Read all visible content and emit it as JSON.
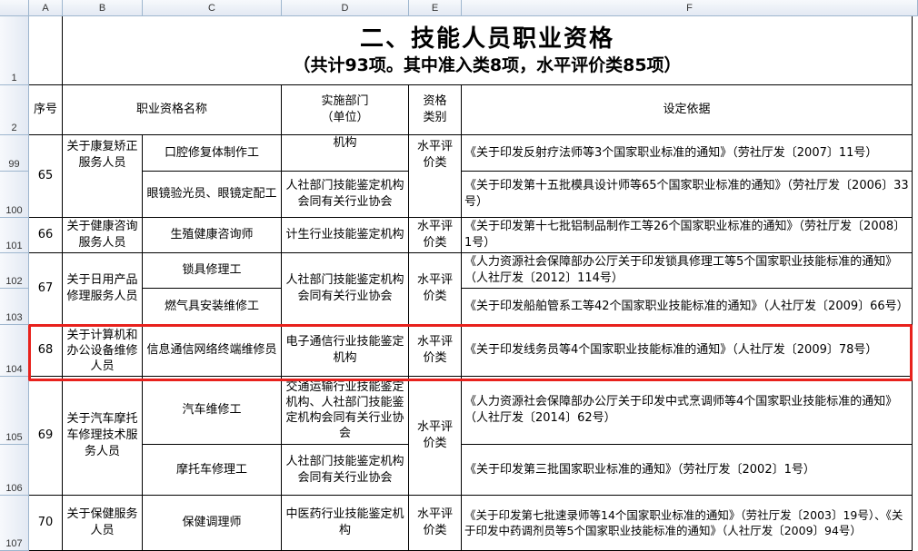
{
  "columns": [
    "A",
    "B",
    "C",
    "D",
    "E",
    "F"
  ],
  "row_numbers": [
    "1",
    "2",
    "99",
    "100",
    "101",
    "102",
    "103",
    "104",
    "105",
    "106",
    "107"
  ],
  "title": {
    "main": "二、技能人员职业资格",
    "sub": "（共计93项。其中准入类8项，水平评价类85项）"
  },
  "header": {
    "seq": "序号",
    "name": "职业资格名称",
    "dept": "实施部门\n（单位）",
    "type": "资格\n类别",
    "basis": "设定依据"
  },
  "rows": {
    "r65": {
      "seq": "65",
      "group": "关于康复矫正服务人员",
      "type": "水平评价类",
      "items": [
        {
          "name": "口腔修复体制作工",
          "dept": "机构",
          "basis": "《关于印发反射疗法师等3个国家职业标准的通知》（劳社厅发〔2007〕11号）"
        },
        {
          "name": "眼镜验光员、眼镜定配工",
          "dept": "人社部门技能鉴定机构会同有关行业协会",
          "basis": "《关于印发第十五批模具设计师等65个国家职业标准的通知》（劳社厅发〔2006〕33号）"
        }
      ]
    },
    "r66": {
      "seq": "66",
      "group": "关于健康咨询服务人员",
      "name": "生殖健康咨询师",
      "dept": "计生行业技能鉴定机构",
      "type": "水平评价类",
      "basis": "《关于印发第十七批铝制品制作工等26个国家职业标准的通知》（劳社厅发〔2008〕1号）"
    },
    "r67": {
      "seq": "67",
      "group": "关于日用产品修理服务人员",
      "dept": "人社部门技能鉴定机构会同有关行业协会",
      "type": "水平评价类",
      "items": [
        {
          "name": "锁具修理工",
          "basis": "《人力资源社会保障部办公厅关于印发锁具修理工等5个国家职业技能标准的通知》（人社厅发〔2012〕114号）"
        },
        {
          "name": "燃气具安装维修工",
          "basis": "《关于印发船舶管系工等42个国家职业技能标准的通知》（人社厅发〔2009〕66号）"
        }
      ]
    },
    "r68": {
      "seq": "68",
      "group": "关于计算机和办公设备维修人员",
      "name": "信息通信网络终端维修员",
      "dept": "电子通信行业技能鉴定机构",
      "type": "水平评价类",
      "basis": "《关于印发线务员等4个国家职业技能标准的通知》（人社厅发〔2009〕78号）"
    },
    "r69": {
      "seq": "69",
      "group": "关于汽车摩托车修理技术服务人员",
      "type": "水平评价类",
      "items": [
        {
          "name": "汽车维修工",
          "dept": "交通运输行业技能鉴定机构、人社部门技能鉴定机构会同有关行业协会",
          "basis": "《人力资源社会保障部办公厅关于印发中式烹调师等4个国家职业技能标准的通知》（人社厅发〔2014〕62号）"
        },
        {
          "name": "摩托车修理工",
          "dept": "人社部门技能鉴定机构会同有关行业协会",
          "basis": "《关于印发第三批国家职业标准的通知》（劳社厅发〔2002〕1号）"
        }
      ]
    },
    "r70": {
      "seq": "70",
      "group": "关于保健服务人员",
      "name": "保健调理师",
      "dept": "中医药行业技能鉴定机构",
      "type": "水平评价类",
      "basis": "《关于印发第七批速录师等14个国家职业标准的通知》（劳社厅发〔2003〕19号）、《关于印发中药调剂员等5个国家职业技能标准的通知》（人社厅发〔2009〕94号）"
    }
  },
  "colors": {
    "highlight": "#e8211c",
    "header_bg": "#e3e9f3"
  }
}
